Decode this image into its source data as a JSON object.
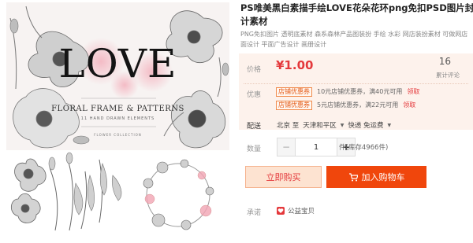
{
  "product": {
    "title_line1": "PS唯美黑白素描手绘LOVE花朵花环png免扣PSD图片封面",
    "title_line2": "计素材",
    "tags_line1": "PNG免扣图片 透明底素材 森系森林产品图装扮 手绘 水彩 网店装扮素材 可做网店",
    "tags_line2": "面设计 平面广告设计 画册设计"
  },
  "image": {
    "headline": "LOVE",
    "subtitle": "FLORAL FRAME & PATTERNS",
    "tagline": "11 HAND DRAWN ELEMENTS",
    "collection": "FLOWER COLLECTION"
  },
  "price": {
    "label": "价格",
    "value": "¥1.00",
    "review_count": "16",
    "review_label": "累计评论"
  },
  "promo": {
    "label": "优惠",
    "coupons": [
      {
        "tag": "店铺优惠券",
        "text": "10元店铺优惠券，满40元可用",
        "action": "领取"
      },
      {
        "tag": "店铺优惠券",
        "text": "5元店铺优惠券，满22元可用",
        "action": "领取"
      }
    ]
  },
  "shipping": {
    "label": "配送",
    "from": "北京 至",
    "to": "天津和平区",
    "method": "快递 免运费"
  },
  "quantity": {
    "label": "数量",
    "minus": "−",
    "value": "1",
    "plus": "+",
    "stock": "件(库存4966件)"
  },
  "actions": {
    "buy_now": "立即购买",
    "add_to_cart": "加入购物车"
  },
  "promise": {
    "label": "承诺",
    "item": "公益宝贝"
  },
  "colors": {
    "accent": "#e4393c",
    "cart_button": "#f0460c",
    "price_bg": "#fdf2ec"
  }
}
